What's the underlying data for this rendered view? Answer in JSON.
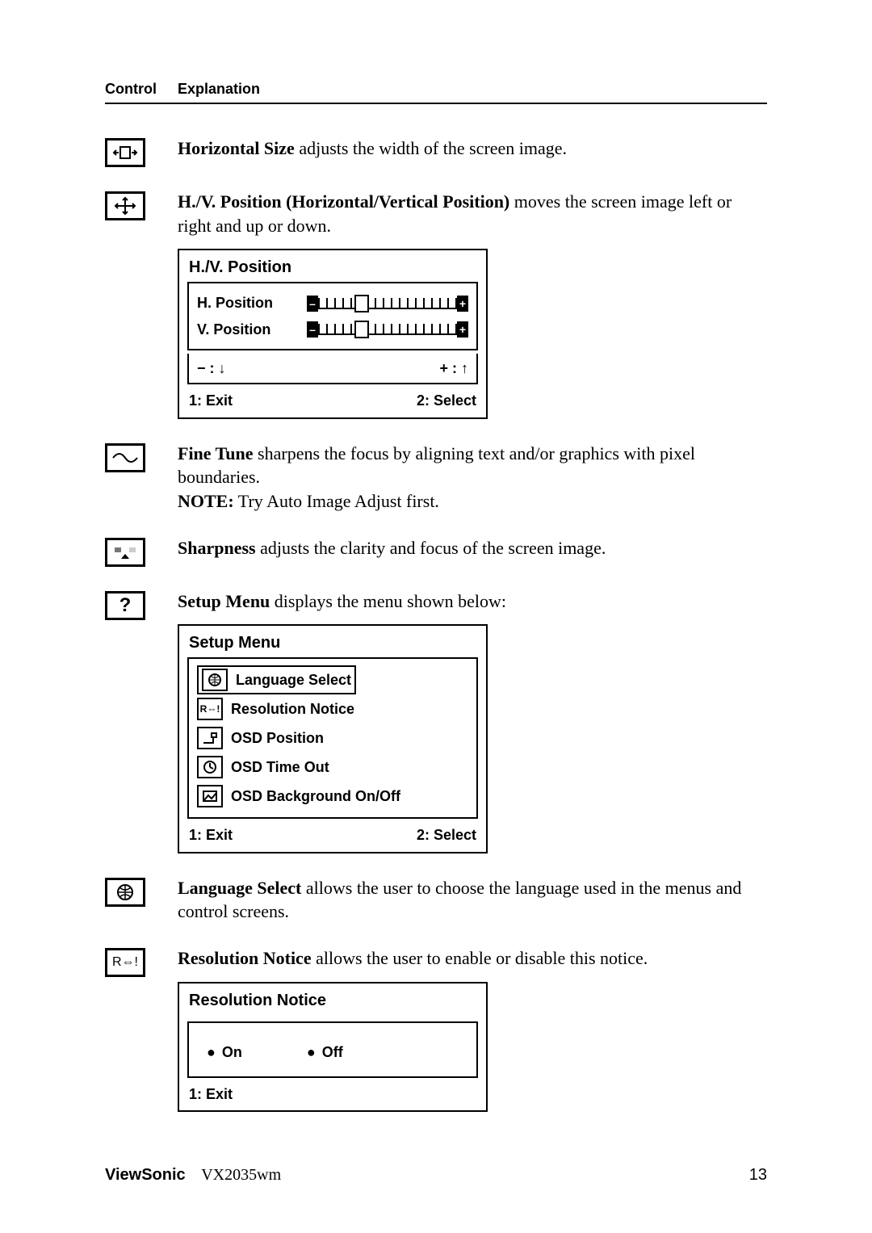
{
  "header": {
    "control": "Control",
    "explanation": "Explanation"
  },
  "horiz_size": {
    "title": "Horizontal Size",
    "text": " adjusts the width of the screen image."
  },
  "hv": {
    "title": "H./V. Position (Horizontal/Vertical Position)",
    "text": " moves the screen image left or right and up or down.",
    "osd_title": "H./V. Position",
    "h_label": "H. Position",
    "v_label": "V. Position",
    "minus": "− : ↓",
    "plus": "+ : ↑",
    "exit": "1: Exit",
    "select": "2: Select"
  },
  "fine": {
    "title": "Fine Tune",
    "text": " sharpens the focus by aligning text and/or graphics with pixel boundaries.",
    "note_label": "NOTE:",
    "note_text": " Try Auto Image Adjust first."
  },
  "sharp": {
    "title": "Sharpness",
    "text": " adjusts the clarity and focus of the screen image."
  },
  "setup": {
    "title": "Setup Menu",
    "text": " displays the menu shown below:",
    "osd_title": "Setup Menu",
    "items": {
      "0": "Language Select",
      "1": "Resolution Notice",
      "2": "OSD Position",
      "3": "OSD Time Out",
      "4": "OSD Background On/Off"
    },
    "exit": "1: Exit",
    "select": "2: Select"
  },
  "lang": {
    "title": "Language Select",
    "text": " allows the user to choose the language used in the menus and control screens."
  },
  "res": {
    "title": "Resolution Notice",
    "text": " allows the user to enable or disable this notice.",
    "osd_title": "Resolution Notice",
    "on": "On",
    "off": "Off",
    "exit": "1: Exit"
  },
  "footer": {
    "brand": "ViewSonic",
    "model": "VX2035wm",
    "page": "13"
  }
}
